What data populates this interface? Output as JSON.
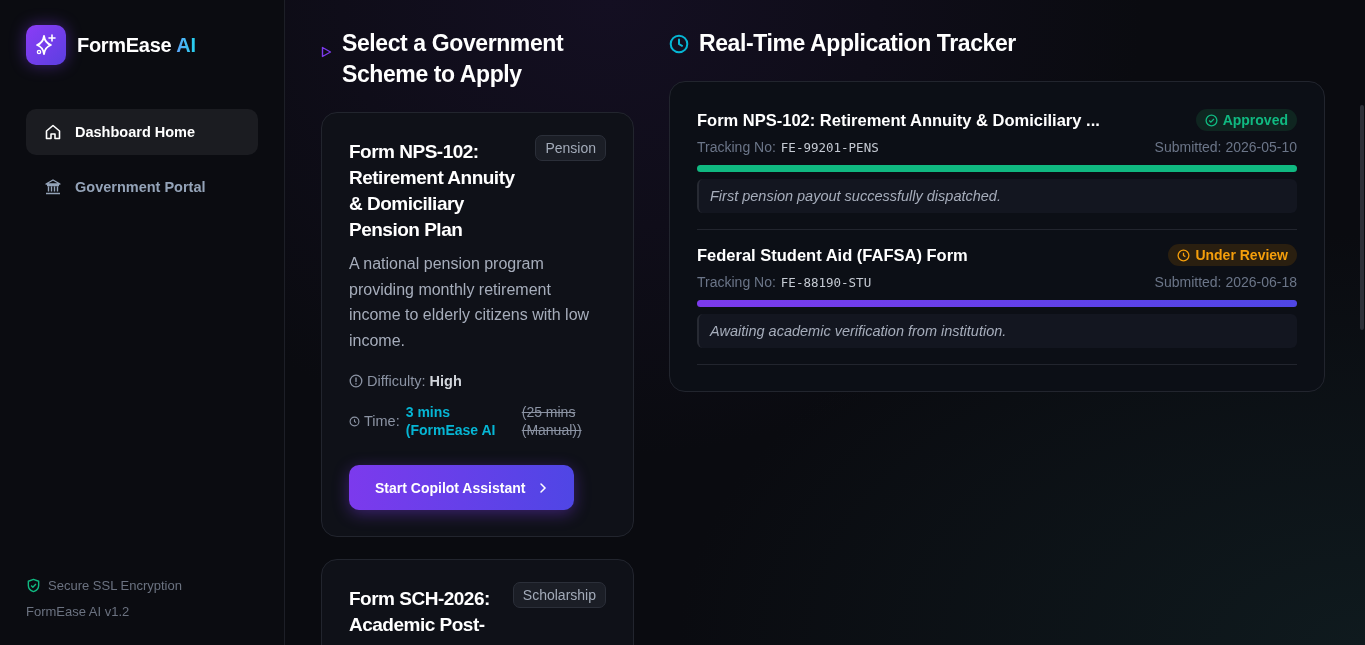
{
  "sidebar": {
    "logo": {
      "name": "FormEase",
      "accent": "AI"
    },
    "nav": [
      {
        "label": "Dashboard Home",
        "kind": "home",
        "selected": true
      },
      {
        "label": "Government Portal",
        "kind": "bank",
        "selected": false
      }
    ],
    "security": "Secure SSL Encryption",
    "version": "FormEase AI v1.2"
  },
  "schemes": {
    "title": "Select a Government Scheme to Apply",
    "cards": [
      {
        "title": "Form NPS-102: Retirement Annuity & Domiciliary Pension Plan",
        "category": "Pension",
        "description": "A national pension program providing monthly retirement income to elderly citizens with low income.",
        "difficulty_label": "Difficulty:",
        "difficulty": "High",
        "time_label": "Time:",
        "time_ai": "3 mins (FormEase AI",
        "time_manual": "(25 mins (Manual))",
        "button": "Start Copilot Assistant"
      },
      {
        "title": "Form SCH-2026: Academic Post-",
        "category": "Scholarship"
      }
    ]
  },
  "tracker": {
    "title": "Real-Time Application Tracker",
    "applications": [
      {
        "title": "Form NPS-102: Retirement Annuity & Domiciliary ...",
        "kind": "approved",
        "status_label": "Approved",
        "tracking_label": "Tracking No:",
        "tracking_no": "FE-99201-PENS",
        "submitted": "Submitted: 2026-05-10",
        "level": 1,
        "note": "First pension payout successfully dispatched."
      },
      {
        "title": "Federal Student Aid (FAFSA) Form",
        "kind": "review",
        "status_label": "Under Review",
        "tracking_label": "Tracking No:",
        "tracking_no": "FE-88190-STU",
        "submitted": "Submitted: 2026-06-18",
        "level": 1,
        "note": "Awaiting academic verification from institution."
      }
    ]
  }
}
